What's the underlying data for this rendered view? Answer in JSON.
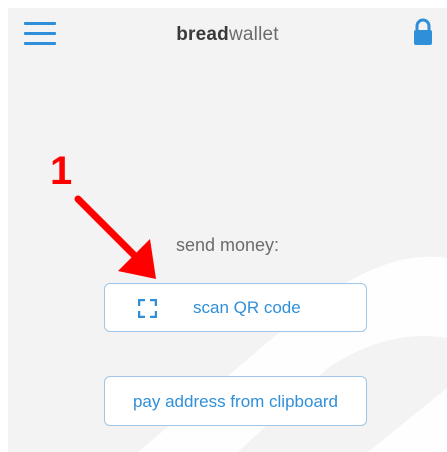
{
  "header": {
    "logo_bold": "bread",
    "logo_light": "wallet",
    "menu_icon": "hamburger-menu-icon",
    "lock_icon": "lock-icon"
  },
  "annotation": {
    "step": "1"
  },
  "send": {
    "label": "send money:",
    "scan_button": "scan QR code",
    "scan_icon": "qr-scan-icon",
    "paste_button": "pay address from clipboard"
  },
  "colors": {
    "accent": "#2f8fd8",
    "annotation": "#ff0000",
    "background": "#f3f3f3"
  }
}
